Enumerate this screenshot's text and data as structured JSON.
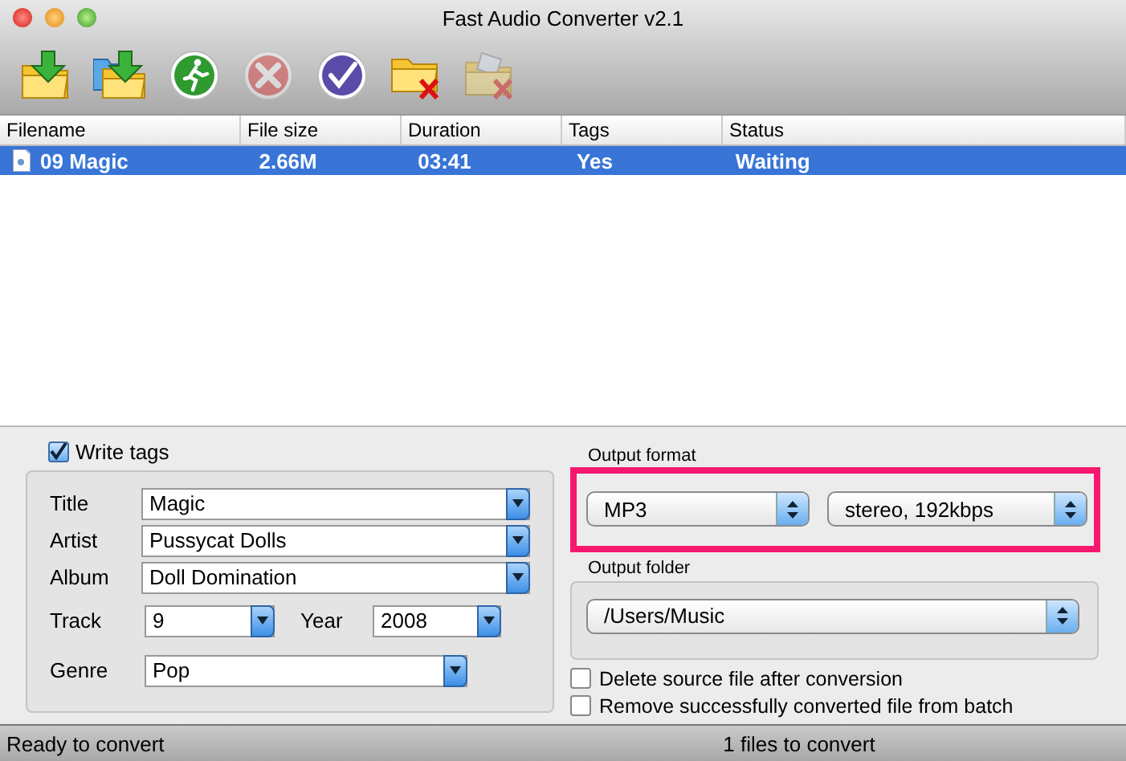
{
  "window": {
    "title": "Fast Audio Converter v2.1"
  },
  "toolbar": [
    {
      "kind": "add-file",
      "disabled": false
    },
    {
      "kind": "add-folder",
      "disabled": false
    },
    {
      "kind": "start",
      "disabled": false
    },
    {
      "kind": "cancel",
      "disabled": true
    },
    {
      "kind": "check",
      "disabled": false
    },
    {
      "kind": "remove",
      "disabled": false
    },
    {
      "kind": "clear",
      "disabled": true
    }
  ],
  "table": {
    "columns": [
      "Filename",
      "File size",
      "Duration",
      "Tags",
      "Status"
    ],
    "rows": [
      {
        "cells": [
          "09 Magic",
          "2.66M",
          "03:41",
          "Yes",
          "Waiting"
        ],
        "selected": true
      }
    ]
  },
  "tags": {
    "write_tags": {
      "label": "Write tags",
      "checked": true
    },
    "fields": [
      {
        "label": "Title",
        "value": "Magic"
      },
      {
        "label": "Artist",
        "value": "Pussycat Dolls"
      },
      {
        "label": "Album",
        "value": "Doll Domination"
      },
      {
        "label": "Track",
        "value": "9"
      },
      {
        "label": "Year",
        "value": "2008"
      },
      {
        "label": "Genre",
        "value": "Pop"
      }
    ]
  },
  "output_format": {
    "label": "Output format",
    "highlighted": true,
    "format": "MP3",
    "quality": "stereo, 192kbps"
  },
  "output_folder": {
    "label": "Output folder",
    "path": "/Users/Music"
  },
  "options": [
    {
      "label": "Delete source file after conversion",
      "checked": false
    },
    {
      "label": "Remove successfully converted file from batch",
      "checked": false
    }
  ],
  "status_bar": {
    "left": "Ready to convert",
    "right": "1 files to convert"
  }
}
